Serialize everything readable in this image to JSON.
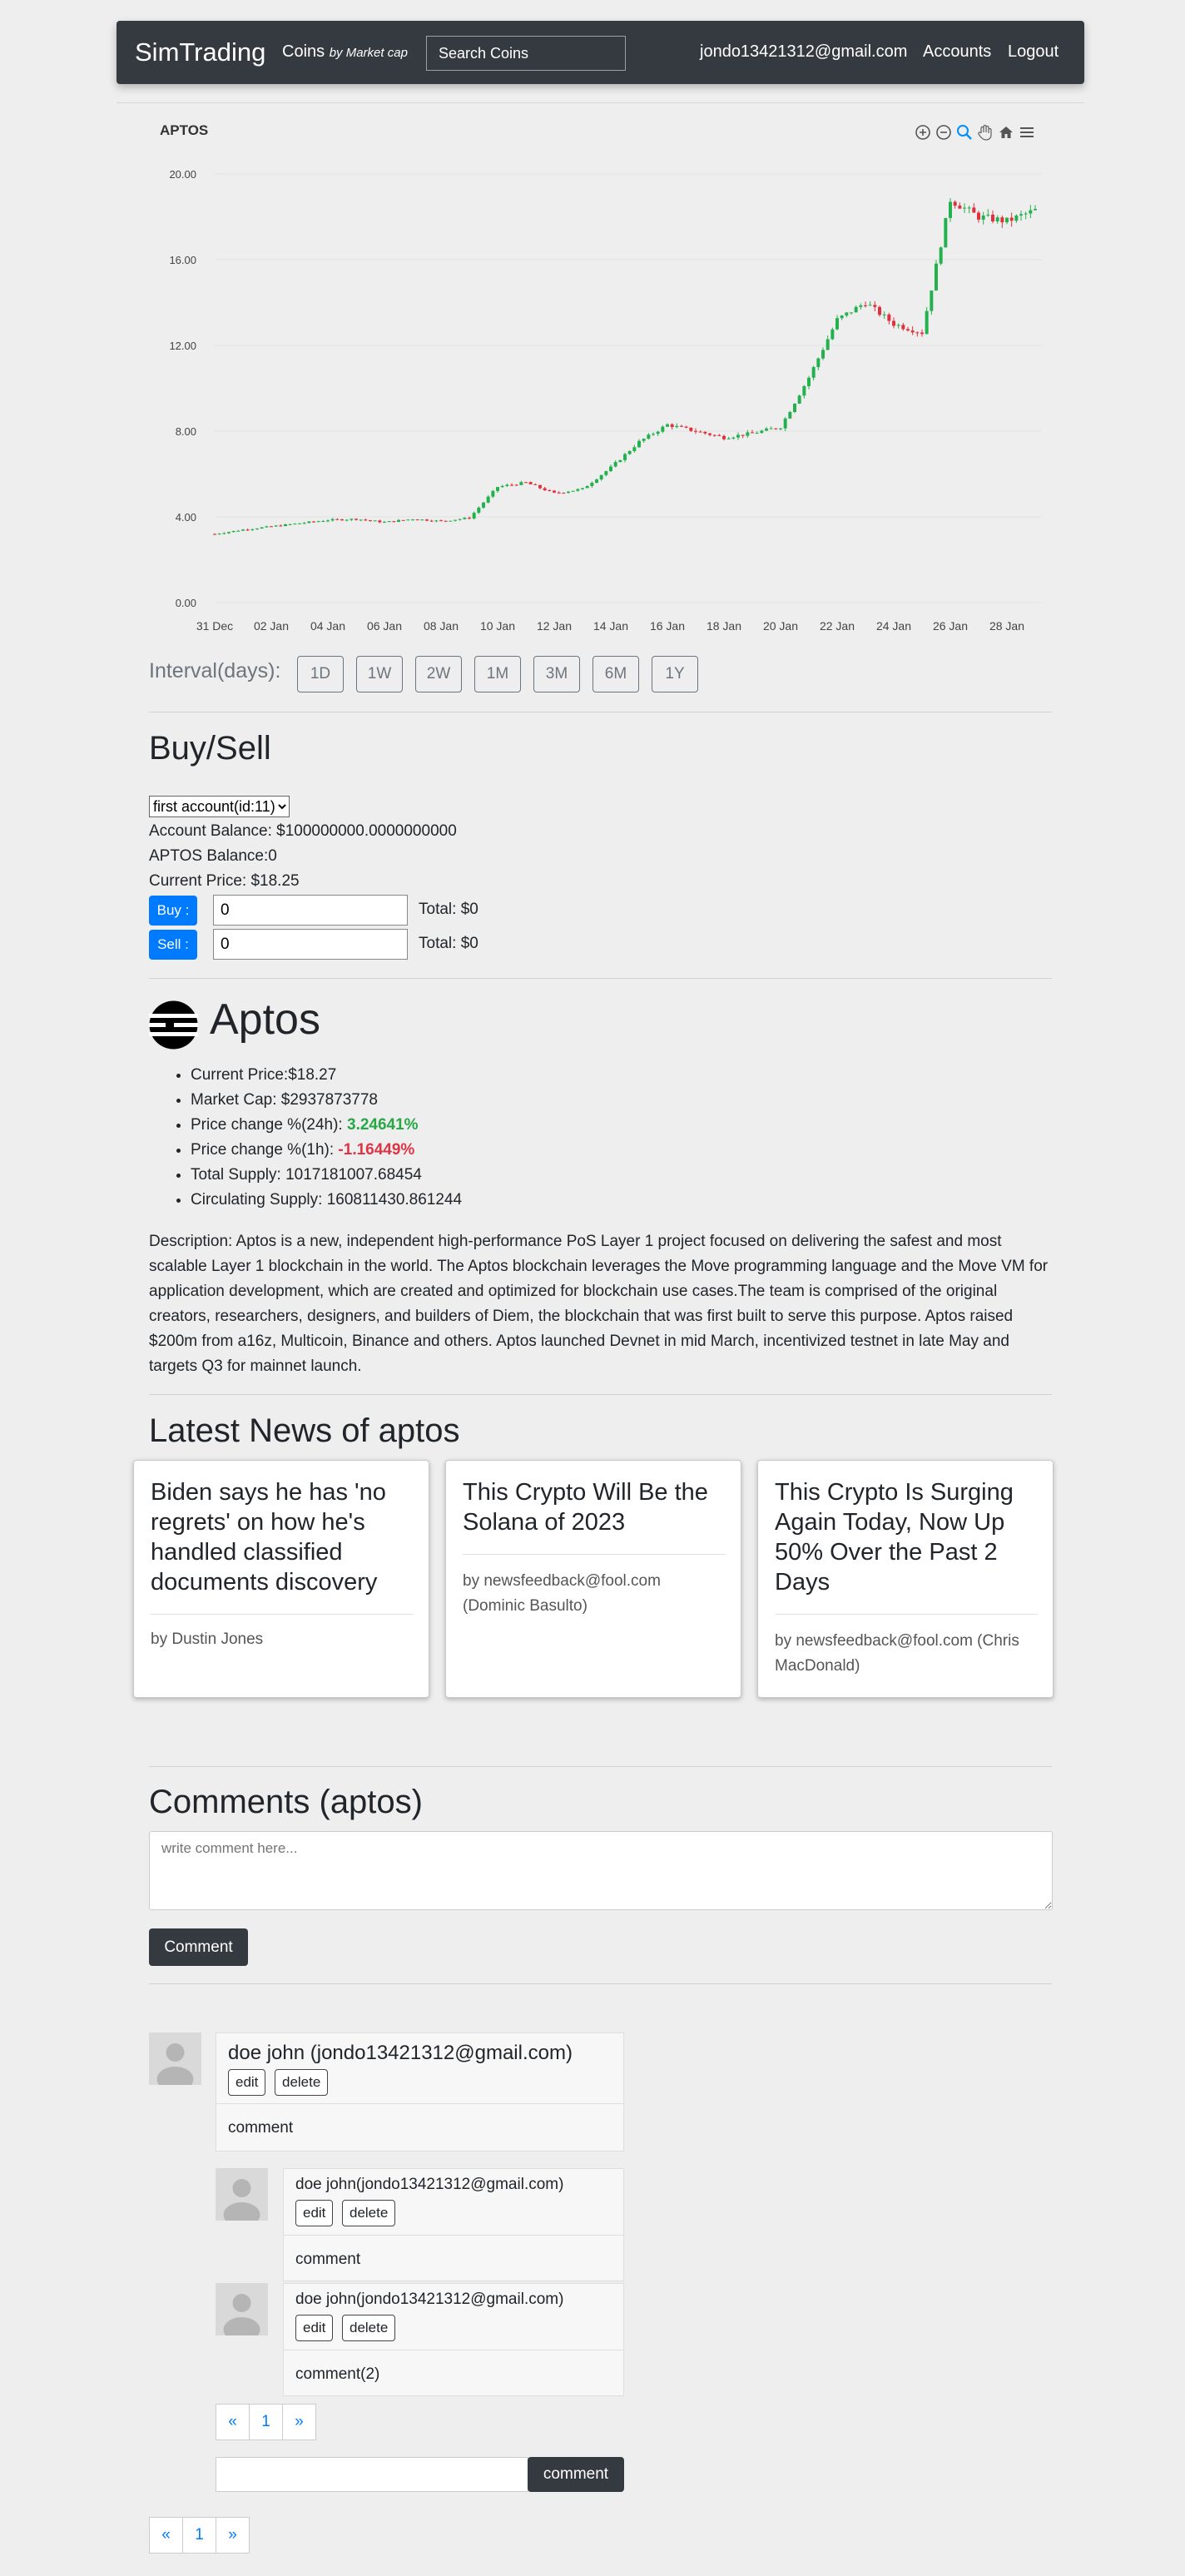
{
  "navbar": {
    "brand": "SimTrading",
    "coins_label": "Coins",
    "coins_sub": "by Market cap",
    "search_placeholder": "Search Coins",
    "user_email": "jondo13421312@gmail.com",
    "accounts": "Accounts",
    "logout": "Logout"
  },
  "chart_data": {
    "type": "candlestick",
    "title": "APTOS",
    "ylim": [
      0,
      20
    ],
    "yticks": [
      "0.00",
      "4.00",
      "8.00",
      "12.00",
      "16.00",
      "20.00"
    ],
    "xticks": [
      "31 Dec",
      "02 Jan",
      "04 Jan",
      "06 Jan",
      "08 Jan",
      "10 Jan",
      "12 Jan",
      "14 Jan",
      "16 Jan",
      "18 Jan",
      "20 Jan",
      "22 Jan",
      "24 Jan",
      "26 Jan",
      "28 Jan"
    ],
    "x_start": "2022-12-31",
    "x_end": "2023-01-29",
    "close_path": [
      [
        "2022-12-31",
        3.2
      ],
      [
        "2023-01-01",
        3.4
      ],
      [
        "2023-01-02",
        3.55
      ],
      [
        "2023-01-03",
        3.7
      ],
      [
        "2023-01-04",
        3.85
      ],
      [
        "2023-01-05",
        3.9
      ],
      [
        "2023-01-06",
        3.75
      ],
      [
        "2023-01-07",
        3.9
      ],
      [
        "2023-01-08",
        3.8
      ],
      [
        "2023-01-09",
        3.95
      ],
      [
        "2023-01-10",
        5.4
      ],
      [
        "2023-01-11",
        5.6
      ],
      [
        "2023-01-12",
        5.1
      ],
      [
        "2023-01-13",
        5.3
      ],
      [
        "2023-01-14",
        6.3
      ],
      [
        "2023-01-15",
        7.5
      ],
      [
        "2023-01-16",
        8.3
      ],
      [
        "2023-01-17",
        8.0
      ],
      [
        "2023-01-18",
        7.7
      ],
      [
        "2023-01-19",
        7.9
      ],
      [
        "2023-01-20",
        8.2
      ],
      [
        "2023-01-21",
        10.5
      ],
      [
        "2023-01-22",
        13.2
      ],
      [
        "2023-01-23",
        14.0
      ],
      [
        "2023-01-24",
        13.0
      ],
      [
        "2023-01-25",
        12.6
      ],
      [
        "2023-01-26",
        18.8
      ],
      [
        "2023-01-27",
        18.0
      ],
      [
        "2023-01-28",
        17.8
      ],
      [
        "2023-01-29",
        18.3
      ]
    ],
    "up_color": "#22b14c",
    "down_color": "#e0303c",
    "grid": true
  },
  "interval": {
    "label": "Interval(days):",
    "options": [
      "1D",
      "1W",
      "2W",
      "1M",
      "3M",
      "6M",
      "1Y"
    ]
  },
  "buysell": {
    "heading": "Buy/Sell",
    "account_option": "first account(id:11)",
    "account_balance": "Account Balance: $100000000.0000000000",
    "coin_balance": "APTOS Balance:0",
    "current_price": "Current Price: $18.25",
    "buy_label": "Buy :",
    "sell_label": "Sell :",
    "buy_value": "0",
    "sell_value": "0",
    "buy_total": "Total: $0",
    "sell_total": "Total: $0"
  },
  "coin": {
    "name": "Aptos",
    "current_price_label": "Current Price:",
    "current_price": "$18.27",
    "market_cap_label": "Market Cap: ",
    "market_cap": "$2937873778",
    "change_24h_label": "Price change %(24h): ",
    "change_24h": "3.24641%",
    "change_1h_label": "Price change %(1h): ",
    "change_1h": "-1.16449%",
    "total_supply_label": "Total Supply: ",
    "total_supply": "1017181007.68454",
    "circulating_label": "Circulating Supply: ",
    "circulating": "160811430.861244",
    "description": "Description: Aptos is a new, independent high-performance PoS Layer 1 project focused on delivering the safest and most scalable Layer 1 blockchain in the world. The Aptos blockchain leverages the Move programming language and the Move VM for application development, which are created and optimized for blockchain use cases.The team is comprised of the original creators, researchers, designers, and builders of Diem, the blockchain that was first built to serve this purpose. Aptos raised $200m from a16z, Multicoin, Binance and others. Aptos launched Devnet in mid March, incentivized testnet in late May and targets Q3 for mainnet launch."
  },
  "news": {
    "heading": "Latest News of aptos",
    "cards": [
      {
        "title": "Biden says he has 'no regrets' on how he's handled classified documents discovery",
        "author": "by Dustin Jones"
      },
      {
        "title": "This Crypto Will Be the Solana of 2023",
        "author": "by newsfeedback@fool.com (Dominic Basulto)"
      },
      {
        "title": "This Crypto Is Surging Again Today, Now Up 50% Over the Past 2 Days",
        "author": "by newsfeedback@fool.com (Chris MacDonald)"
      }
    ]
  },
  "comments": {
    "heading": "Comments (aptos)",
    "placeholder": "write comment here...",
    "submit": "Comment",
    "edit": "edit",
    "delete": "delete",
    "main": {
      "author": "doe john (jondo13421312@gmail.com)",
      "body": "comment"
    },
    "replies": [
      {
        "author": "doe john(jondo13421312@gmail.com)",
        "body": "comment"
      },
      {
        "author": "doe john(jondo13421312@gmail.com)",
        "body": "comment(2)"
      }
    ],
    "pager": {
      "prev": "«",
      "page": "1",
      "next": "»"
    },
    "reply_button": "comment"
  }
}
